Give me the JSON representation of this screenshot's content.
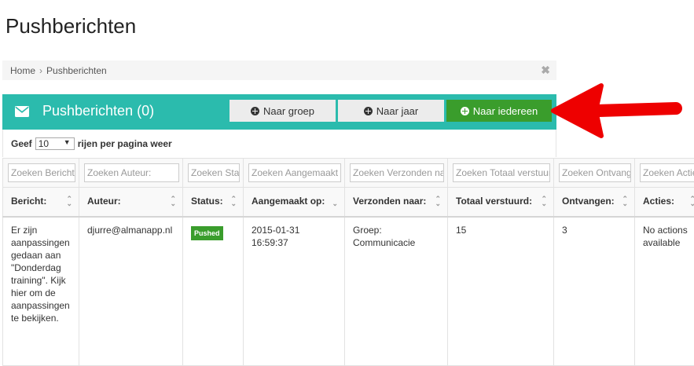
{
  "page": {
    "title": "Pushberichten"
  },
  "breadcrumb": {
    "home": "Home",
    "separator": "›",
    "current": "Pushberichten",
    "close": "✖"
  },
  "panel": {
    "title": "Pushberichten (0)",
    "buttons": [
      {
        "label": "Naar groep"
      },
      {
        "label": "Naar jaar"
      },
      {
        "label": "Naar iedereen"
      }
    ]
  },
  "length_menu": {
    "prefix": "Geef",
    "selected": "10",
    "suffix": "rijen per pagina weer"
  },
  "table": {
    "filters": [
      "Zoeken Bericht",
      "Zoeken Auteur:",
      "Zoeken Status:",
      "Zoeken Aangemaakt op:",
      "Zoeken Verzonden naar:",
      "Zoeken Totaal verstuurd:",
      "Zoeken Ontvangen:",
      "Zoeken Acties:"
    ],
    "columns": [
      "Bericht:",
      "Auteur:",
      "Status:",
      "Aangemaakt op:",
      "Verzonden naar:",
      "Totaal verstuurd:",
      "Ontvangen:",
      "Acties:"
    ],
    "rows": [
      {
        "bericht": "Er zijn aanpassingen gedaan aan \"Donderdag training\". Kijk hier om de aanpassingen te bekijken.",
        "auteur": "djurre@almanapp.nl",
        "status": "Pushed",
        "aangemaakt": "2015-01-31 16:59:37",
        "verzonden": "Groep: Communicacie",
        "totaal": "15",
        "ontvangen": "3",
        "acties": "No actions available"
      }
    ]
  },
  "colors": {
    "header_teal": "#2bbbad",
    "green": "#3a9d2c",
    "arrow_red": "#ee0000"
  }
}
